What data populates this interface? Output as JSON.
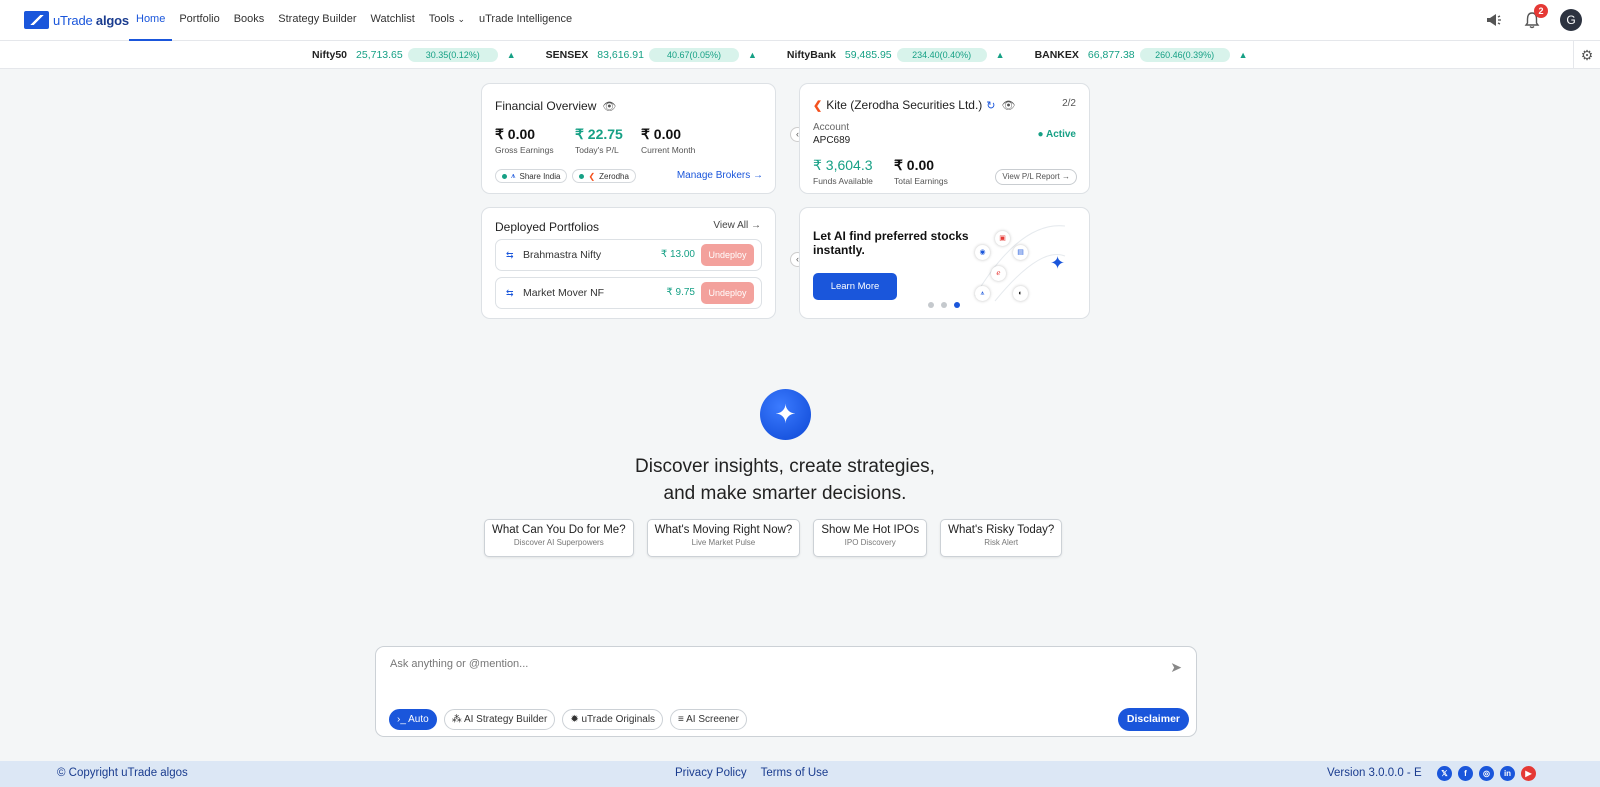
{
  "brand": {
    "name_light": "uTrade ",
    "name_bold": "algos"
  },
  "nav": {
    "links": [
      "Home",
      "Portfolio",
      "Books",
      "Strategy Builder",
      "Watchlist",
      "Tools",
      "uTrade Intelligence"
    ],
    "active": "Home",
    "notifications_count": "2",
    "avatar_letter": "G"
  },
  "ticker": [
    {
      "name": "Nifty50",
      "value": "25,713.65",
      "change": "30.35(0.12%)",
      "direction": "up"
    },
    {
      "name": "SENSEX",
      "value": "83,616.91",
      "change": "40.67(0.05%)",
      "direction": "up"
    },
    {
      "name": "NiftyBank",
      "value": "59,485.95",
      "change": "234.40(0.40%)",
      "direction": "up"
    },
    {
      "name": "BANKEX",
      "value": "66,877.38",
      "change": "260.46(0.39%)",
      "direction": "up"
    }
  ],
  "financial_overview": {
    "title": "Financial Overview",
    "stats": [
      {
        "value": "₹ 0.00",
        "label": "Gross Earnings",
        "color": "#111111"
      },
      {
        "value": "₹ 22.75",
        "label": "Today's P/L",
        "color": "#16a085"
      },
      {
        "value": "₹ 0.00",
        "label": "Current Month",
        "color": "#111111"
      }
    ],
    "brokers": [
      "Share India",
      "Zerodha"
    ],
    "manage_link": "Manage Brokers →"
  },
  "broker_card": {
    "title": "Kite (Zerodha Securities Ltd.)",
    "pager": "2/2",
    "account_label": "Account",
    "account_id": "APC689",
    "status": "● Active",
    "funds": {
      "value": "₹ 3,604.3",
      "label": "Funds Available"
    },
    "earnings": {
      "value": "₹ 0.00",
      "label": "Total Earnings"
    },
    "report_button": "View P/L Report →"
  },
  "deployed": {
    "title": "Deployed Portfolios",
    "view_all": "View All →",
    "items": [
      {
        "name": "Brahmastra Nifty",
        "value": "₹ 13.00",
        "action": "Undeploy"
      },
      {
        "name": "Market Mover NF",
        "value": "₹ 9.75",
        "action": "Undeploy"
      }
    ]
  },
  "ai_promo": {
    "headline": "Let AI find preferred stocks instantly.",
    "button": "Learn More",
    "slides": 3,
    "active_slide": 3
  },
  "hero": {
    "line1": "Discover insights, create strategies,",
    "line2": "and make smarter decisions."
  },
  "prompts": [
    {
      "title": "What Can You Do for Me?",
      "sub": "Discover AI Superpowers"
    },
    {
      "title": "What's Moving Right Now?",
      "sub": "Live Market Pulse"
    },
    {
      "title": "Show Me Hot IPOs",
      "sub": "IPO Discovery"
    },
    {
      "title": "What's Risky Today?",
      "sub": "Risk Alert"
    }
  ],
  "chat": {
    "placeholder": "Ask anything or @mention...",
    "tools": [
      "Auto",
      "AI Strategy Builder",
      "uTrade Originals",
      "AI Screener"
    ],
    "active_tool": "Auto",
    "disclaimer": "Disclaimer"
  },
  "footer": {
    "copyright": "© Copyright uTrade algos",
    "links": [
      "Privacy Policy",
      "Terms of Use"
    ],
    "version": "Version 3.0.0.0 - E",
    "socials": [
      {
        "name": "x-icon",
        "glyph": "𝕏",
        "color": "#1a56db"
      },
      {
        "name": "facebook-icon",
        "glyph": "f",
        "color": "#1a56db"
      },
      {
        "name": "instagram-icon",
        "glyph": "◎",
        "color": "#1a56db"
      },
      {
        "name": "linkedin-icon",
        "glyph": "in",
        "color": "#1a56db"
      },
      {
        "name": "youtube-icon",
        "glyph": "▶",
        "color": "#e53935"
      }
    ]
  }
}
